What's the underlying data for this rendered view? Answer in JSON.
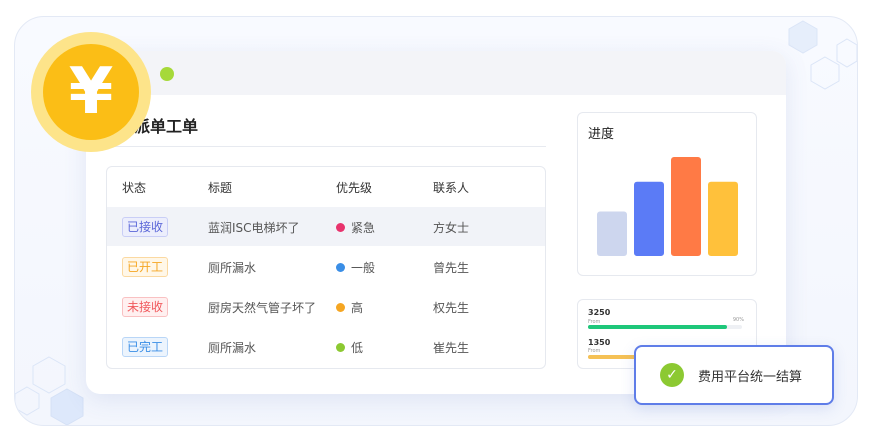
{
  "section": {
    "title": "派单工单"
  },
  "table": {
    "headers": [
      "状态",
      "标题",
      "优先级",
      "联系人"
    ],
    "rows": [
      {
        "status": "已接收",
        "title": "蓝润ISC电梯坏了",
        "priority": "紧急",
        "contact": "方女士"
      },
      {
        "status": "已开工",
        "title": "厕所漏水",
        "priority": "一般",
        "contact": "曾先生"
      },
      {
        "status": "未接收",
        "title": "厨房天然气管子坏了",
        "priority": "高",
        "contact": "权先生"
      },
      {
        "status": "已完工",
        "title": "厕所漏水",
        "priority": "低",
        "contact": "崔先生"
      }
    ]
  },
  "progress": {
    "title": "进度",
    "bars": [
      {
        "color": "#cdd6ee",
        "value": 0.45
      },
      {
        "color": "#5b7bf6",
        "value": 0.75
      },
      {
        "color": "#ff7a45",
        "value": 1.0
      },
      {
        "color": "#ffc13b",
        "value": 0.75
      }
    ]
  },
  "stats": [
    {
      "value": "3250",
      "from": "From",
      "percent": "90%",
      "fill": 0.9,
      "color": "#1ec77a"
    },
    {
      "value": "1350",
      "from": "From",
      "percent": "",
      "fill": 0.55,
      "color": "#f5c155"
    }
  ],
  "toast": {
    "text": "费用平台统一结算"
  },
  "coin": {
    "symbol": "¥"
  },
  "colors": {
    "priority_urgent": "#e8336d",
    "priority_normal": "#3a8ee6",
    "priority_high": "#f5a623",
    "priority_low": "#8cc932"
  }
}
